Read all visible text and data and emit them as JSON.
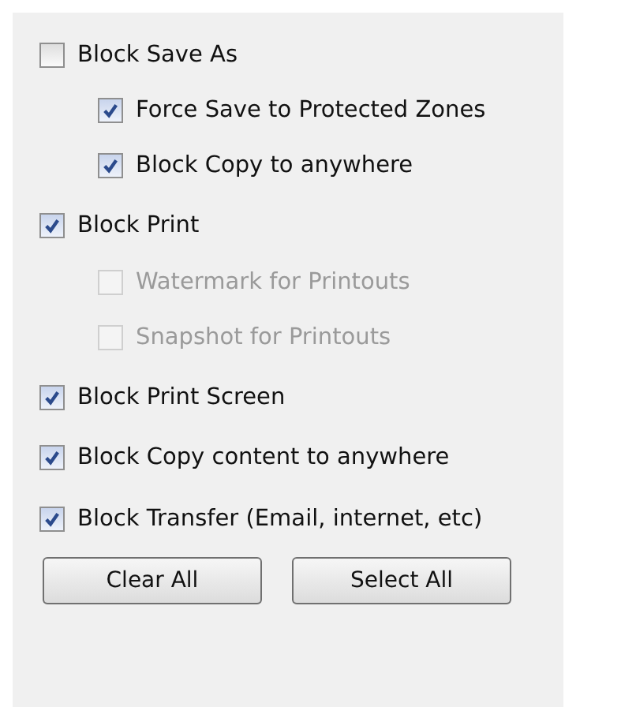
{
  "options": [
    {
      "label": "Block Save As",
      "checked": false,
      "disabled": false,
      "children": [
        {
          "label": "Force Save to Protected Zones",
          "checked": true,
          "disabled": false
        },
        {
          "label": "Block Copy to anywhere",
          "checked": true,
          "disabled": false
        }
      ]
    },
    {
      "label": "Block Print",
      "checked": true,
      "disabled": false,
      "children": [
        {
          "label": "Watermark for Printouts",
          "checked": false,
          "disabled": true
        },
        {
          "label": "Snapshot for Printouts",
          "checked": false,
          "disabled": true
        }
      ]
    },
    {
      "label": "Block Print Screen",
      "checked": true,
      "disabled": false
    },
    {
      "label": "Block Copy content to anywhere",
      "checked": true,
      "disabled": false
    },
    {
      "label": "Block Transfer (Email, internet, etc)",
      "checked": true,
      "disabled": false
    }
  ],
  "buttons": [
    "Clear All",
    "Select All"
  ]
}
